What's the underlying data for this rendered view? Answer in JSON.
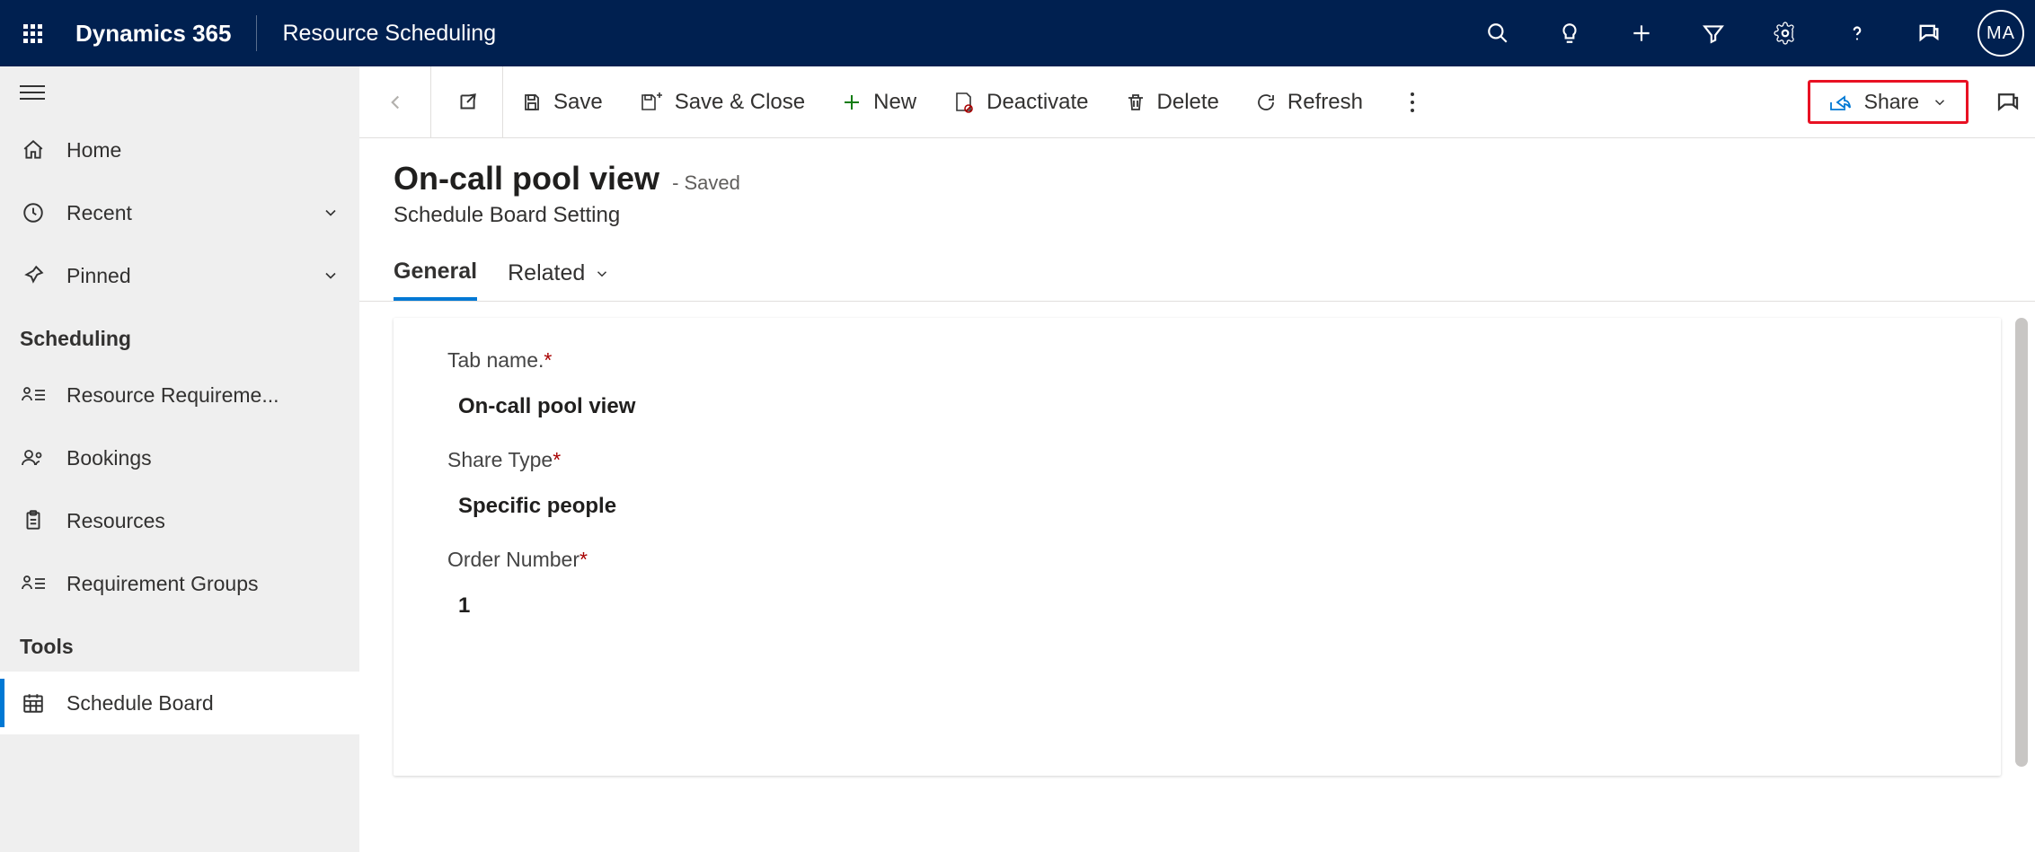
{
  "header": {
    "brand": "Dynamics 365",
    "app": "Resource Scheduling",
    "avatar": "MA"
  },
  "nav": {
    "home": "Home",
    "recent": "Recent",
    "pinned": "Pinned",
    "section_scheduling": "Scheduling",
    "resource_req": "Resource Requireme...",
    "bookings": "Bookings",
    "resources": "Resources",
    "req_groups": "Requirement Groups",
    "section_tools": "Tools",
    "schedule_board": "Schedule Board"
  },
  "commands": {
    "save": "Save",
    "save_close": "Save & Close",
    "new": "New",
    "deactivate": "Deactivate",
    "delete": "Delete",
    "refresh": "Refresh",
    "share": "Share"
  },
  "record": {
    "title": "On-call pool view",
    "status": "- Saved",
    "entity": "Schedule Board Setting"
  },
  "tabs": {
    "general": "General",
    "related": "Related"
  },
  "form": {
    "tab_name_label": "Tab name.",
    "tab_name_value": "On-call pool view",
    "share_type_label": "Share Type",
    "share_type_value": "Specific people",
    "order_number_label": "Order Number",
    "order_number_value": "1"
  }
}
